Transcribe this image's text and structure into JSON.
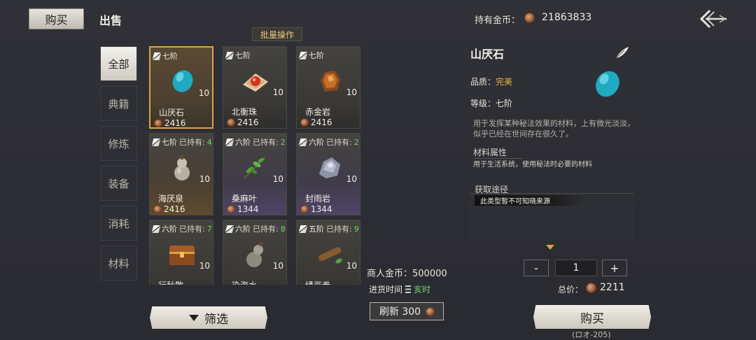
{
  "top": {
    "tab_buy": "购买",
    "tab_sell": "出售",
    "batch_label": "批量操作",
    "coins_label": "持有金币：",
    "coins_value": "21863833",
    "coin_icon": "coin-icon",
    "back_icon": "back-arrow-icon"
  },
  "categories": [
    "全部",
    "典籍",
    "修炼",
    "装备",
    "消耗",
    "材料"
  ],
  "active_category": "全部",
  "items": [
    {
      "rank": "七阶",
      "owned_label": "",
      "owned": "",
      "name": "山厌石",
      "qty": "10",
      "price": "2416",
      "icon": "turquoise-gem-icon",
      "style": "gold",
      "selected": true
    },
    {
      "rank": "七阶",
      "owned_label": "",
      "owned": "",
      "name": "北衡珠",
      "qty": "10",
      "price": "2416",
      "icon": "red-pearl-icon",
      "style": "",
      "selected": false
    },
    {
      "rank": "七阶",
      "owned_label": "",
      "owned": "",
      "name": "赤金岩",
      "qty": "10",
      "price": "2416",
      "icon": "amber-rock-icon",
      "style": "",
      "selected": false
    },
    {
      "rank": "七阶",
      "owned_label": "已持有:",
      "owned": "4",
      "name": "海厌泉",
      "qty": "10",
      "price": "2416",
      "icon": "gourd-icon",
      "style": "gold",
      "selected": false
    },
    {
      "rank": "六阶",
      "owned_label": "已持有:",
      "owned": "2",
      "name": "桑麻叶",
      "qty": "10",
      "price": "1344",
      "icon": "leaf-branch-icon",
      "style": "purple",
      "selected": false
    },
    {
      "rank": "六阶",
      "owned_label": "已持有:",
      "owned": "2",
      "name": "封雨岩",
      "qty": "10",
      "price": "1344",
      "icon": "grey-crystal-icon",
      "style": "purple",
      "selected": false
    },
    {
      "rank": "六阶",
      "owned_label": "已持有:",
      "owned": "7",
      "name": "行秋散",
      "qty": "10",
      "price": "",
      "icon": "chest-icon",
      "style": "",
      "selected": false
    },
    {
      "rank": "六阶",
      "owned_label": "已持有:",
      "owned": "8",
      "name": "染海水",
      "qty": "10",
      "price": "",
      "icon": "gourd-icon",
      "style": "",
      "selected": false
    },
    {
      "rank": "五阶",
      "owned_label": "已持有:",
      "owned": "9",
      "name": "绣画卷",
      "qty": "10",
      "price": "",
      "icon": "scroll-icon",
      "style": "",
      "selected": false
    }
  ],
  "merchant": {
    "coins_label": "商人金币：",
    "coins_value": "500000",
    "restock_label": "进货时间",
    "restock_time": "亥时",
    "refresh_label": "刷新 300"
  },
  "filter_label": "筛选",
  "detail": {
    "title": "山厌石",
    "quality_label": "品质：",
    "quality_value": "完美",
    "grade_label": "等级：",
    "grade_value": "七阶",
    "description": "用于发挥某种秘法效果的材料，上有微光淡淡，似乎已经在世间存在很久了。",
    "attr_header": "材料属性",
    "attr_text": "用于生活系统，使用秘法时必要的材料",
    "source_header": "获取途径",
    "source_text": "此类型暂不可知晓来源",
    "quantity": "1",
    "minus": "-",
    "plus": "+",
    "total_label": "总价：",
    "total_value": "2211",
    "buy_label": "购买",
    "footer_code": "(ロオ-205)"
  },
  "colors": {
    "accent_gold": "#d9a441",
    "owned_green": "#6fd36a",
    "quality_gold": "#e7b83c",
    "background": "#2b2c32"
  }
}
